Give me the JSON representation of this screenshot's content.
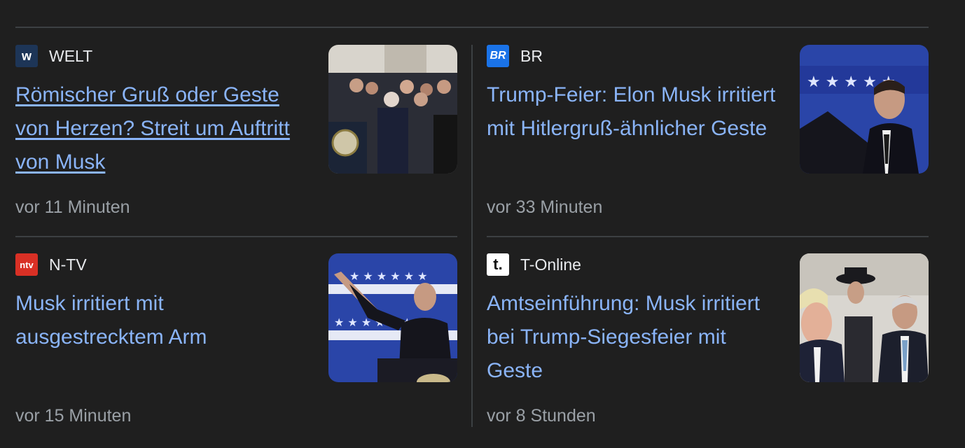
{
  "articles": [
    {
      "source": "WELT",
      "logo_text": "w",
      "logo_bg": "#1d3557",
      "logo_fg": "#ffffff",
      "headline": "Römischer Gruß oder Geste von Herzen? Streit um Auftritt von Musk",
      "time": "vor 11 Minuten",
      "visited": true
    },
    {
      "source": "BR",
      "logo_text": "BR",
      "logo_bg": "#1a73e8",
      "logo_fg": "#ffffff",
      "headline": "Trump-Feier: Elon Musk irritiert mit Hitlergruß-ähnlicher Geste",
      "time": "vor 33 Minuten",
      "visited": false
    },
    {
      "source": "N-TV",
      "logo_text": "ntv",
      "logo_bg": "#d93025",
      "logo_fg": "#ffffff",
      "headline": "Musk irritiert mit ausgestrecktem Arm",
      "time": "vor 15 Minuten",
      "visited": false
    },
    {
      "source": "T-Online",
      "logo_text": "t.",
      "logo_bg": "#ffffff",
      "logo_fg": "#111111",
      "headline": "Amtseinführung: Musk irritiert bei Trump-Siegesfeier mit Geste",
      "time": "vor 8 Stunden",
      "visited": false
    }
  ],
  "colors": {
    "background": "#1f1f1f",
    "link": "#8ab4f8",
    "muted": "#9aa0a6",
    "divider": "#3c4043"
  }
}
